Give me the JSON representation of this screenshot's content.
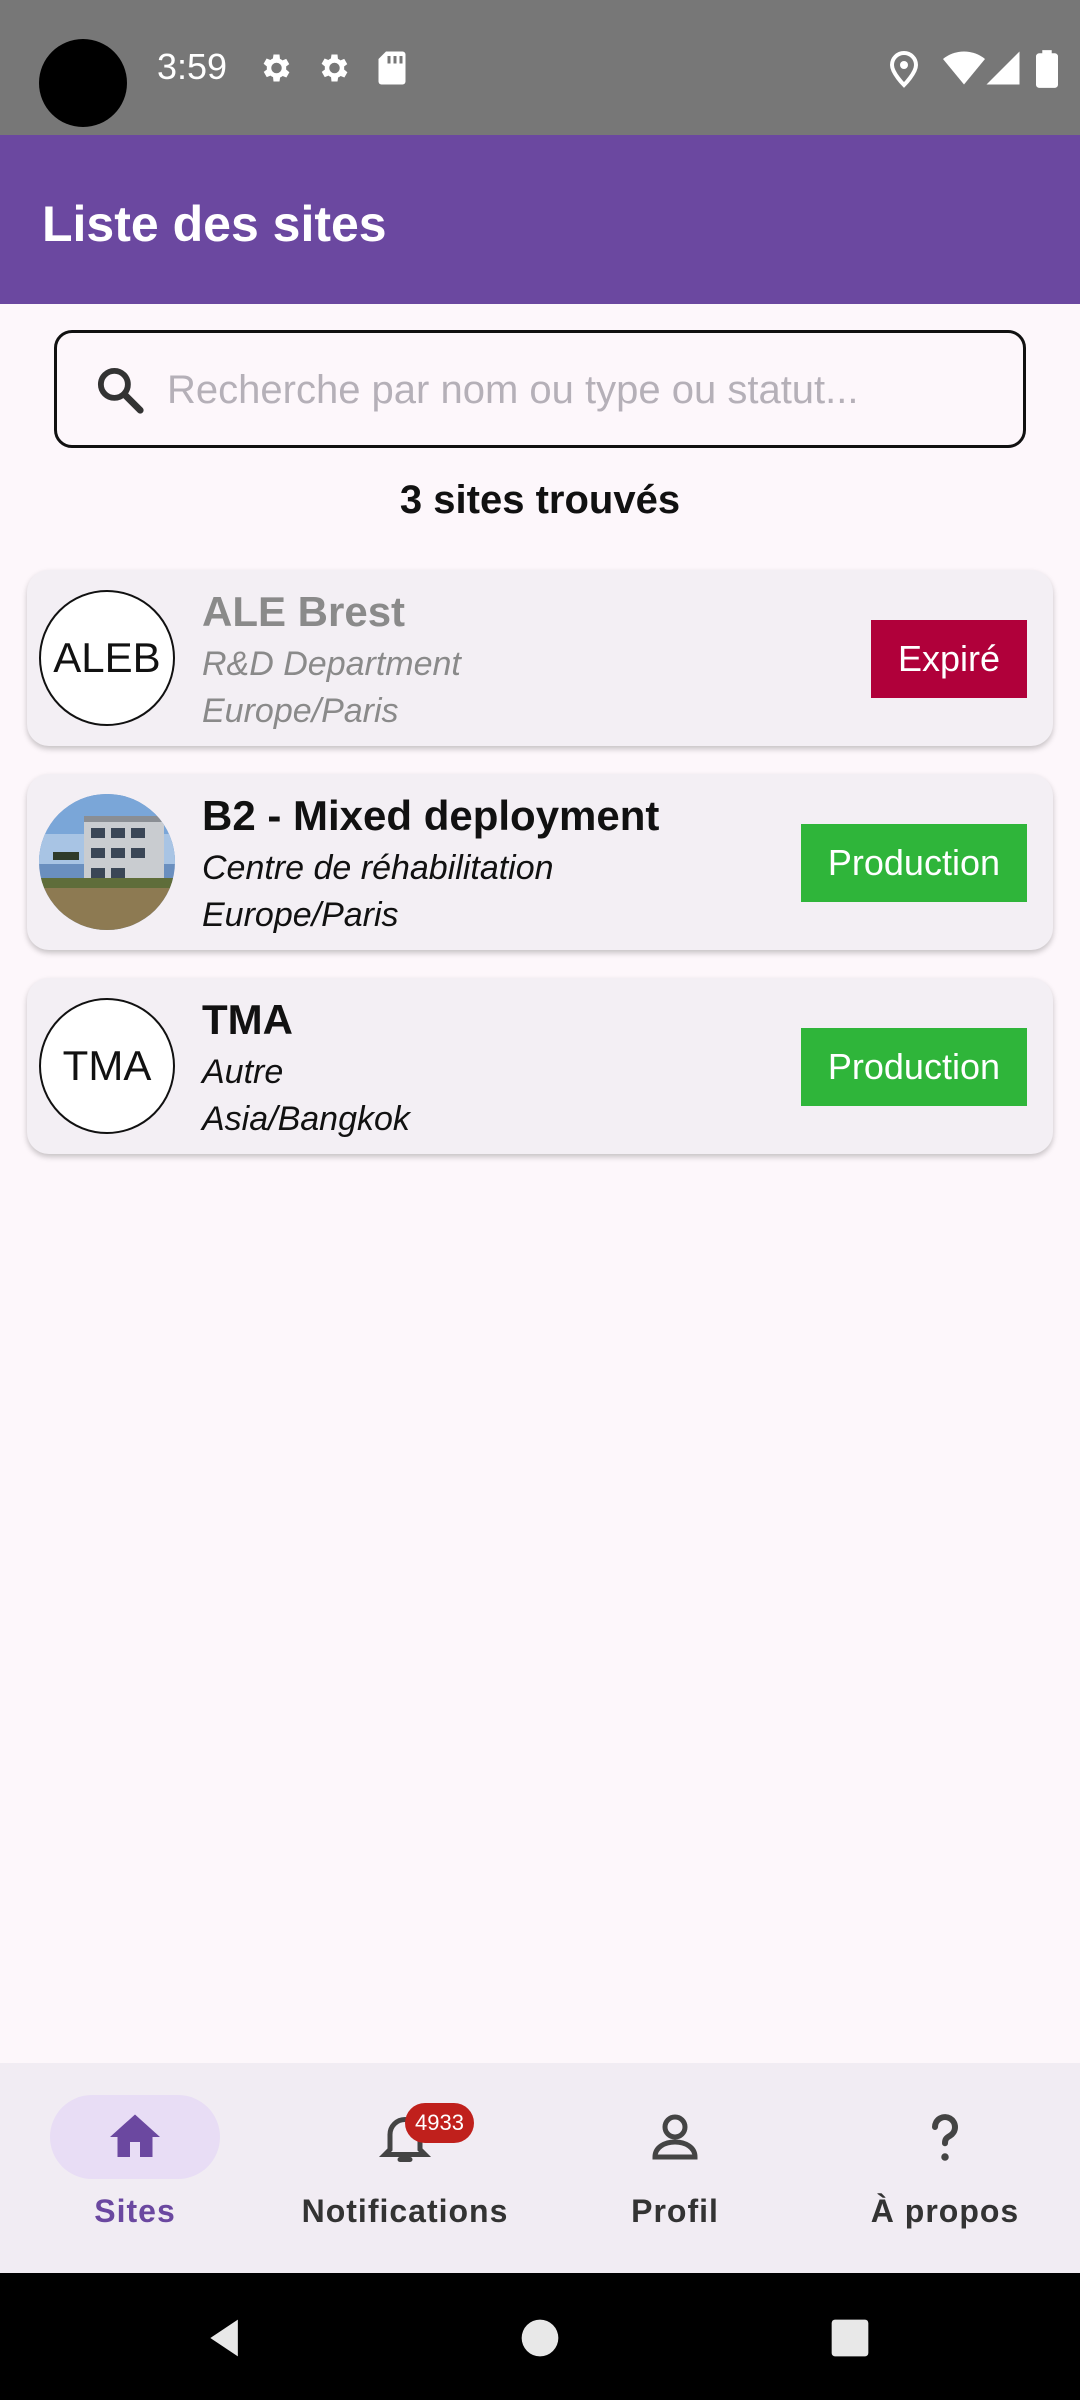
{
  "status_bar": {
    "time": "3:59",
    "icons": [
      "settings-icon",
      "settings-icon",
      "sd-card-icon",
      "location-icon",
      "wifi-icon",
      "signal-icon",
      "battery-icon"
    ]
  },
  "app_bar": {
    "title": "Liste des sites"
  },
  "search": {
    "placeholder": "Recherche par nom ou type ou statut...",
    "value": ""
  },
  "results": {
    "count_text": "3 sites trouvés"
  },
  "sites": [
    {
      "name": "ALE Brest",
      "subtitle": "R&D Department",
      "timezone": "Europe/Paris",
      "avatar_text": "ALEB",
      "status": "Expiré",
      "status_color": "#b0003a",
      "dimmed": true
    },
    {
      "name": "B2 - Mixed deployment",
      "subtitle": "Centre de réhabilitation",
      "timezone": "Europe/Paris",
      "avatar_text": "",
      "status": "Production",
      "status_color": "#2fb53a",
      "dimmed": false
    },
    {
      "name": "TMA",
      "subtitle": "Autre",
      "timezone": "Asia/Bangkok",
      "avatar_text": "TMA",
      "status": "Production",
      "status_color": "#2fb53a",
      "dimmed": false
    }
  ],
  "bottom_nav": {
    "items": [
      {
        "label": "Sites",
        "icon": "home-icon",
        "active": true
      },
      {
        "label": "Notifications",
        "icon": "bell-icon",
        "badge": "4933",
        "active": false
      },
      {
        "label": "Profil",
        "icon": "person-icon",
        "active": false
      },
      {
        "label": "À propos",
        "icon": "question-icon",
        "active": false
      }
    ]
  },
  "colors": {
    "primary": "#6b48a0",
    "expired": "#b0003a",
    "production": "#2fb53a",
    "badge": "#c0201c"
  }
}
